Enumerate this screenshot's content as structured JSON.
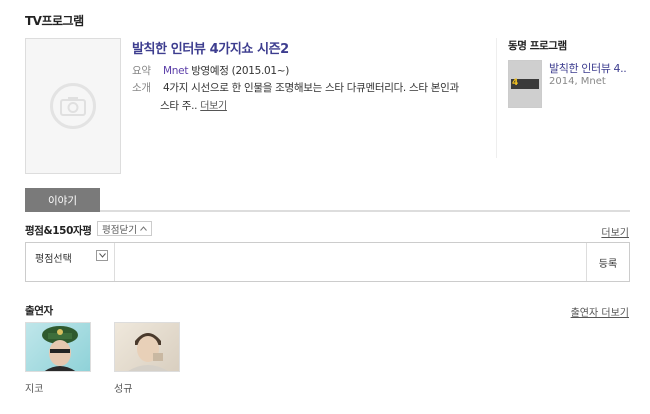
{
  "header": {
    "title": "TV프로그램"
  },
  "program": {
    "title": "발칙한 인터뷰 4가지쇼 시즌2",
    "summary_label": "요약",
    "channel": "Mnet",
    "status": "방영예정 (2015.01~)",
    "desc_label": "소개",
    "description_line1": "4가지 시선으로 한 인물을 조명해보는 스타 다큐멘터리다. 스타 본인과",
    "description_line2": "스타 주..",
    "more_label": "더보기"
  },
  "same_name": {
    "title": "동명 프로그램",
    "items": [
      {
        "name": "발칙한 인터뷰 4..",
        "meta": "2014, Mnet",
        "thumb_text": "4"
      }
    ]
  },
  "tabs": [
    {
      "label": "이야기"
    }
  ],
  "rating": {
    "title": "평점&150자평",
    "toggle_label": "평점닫기",
    "more_label": "더보기",
    "select_label": "평점선택",
    "submit_label": "등록",
    "input_placeholder": ""
  },
  "cast": {
    "title": "출연자",
    "more_label": "출연자 더보기",
    "members": [
      {
        "name": "지코"
      },
      {
        "name": "성규"
      }
    ]
  },
  "colors": {
    "title_link": "#3d3d8f",
    "channel": "#5b3ea8",
    "tab_bg": "#7a7a7a"
  }
}
